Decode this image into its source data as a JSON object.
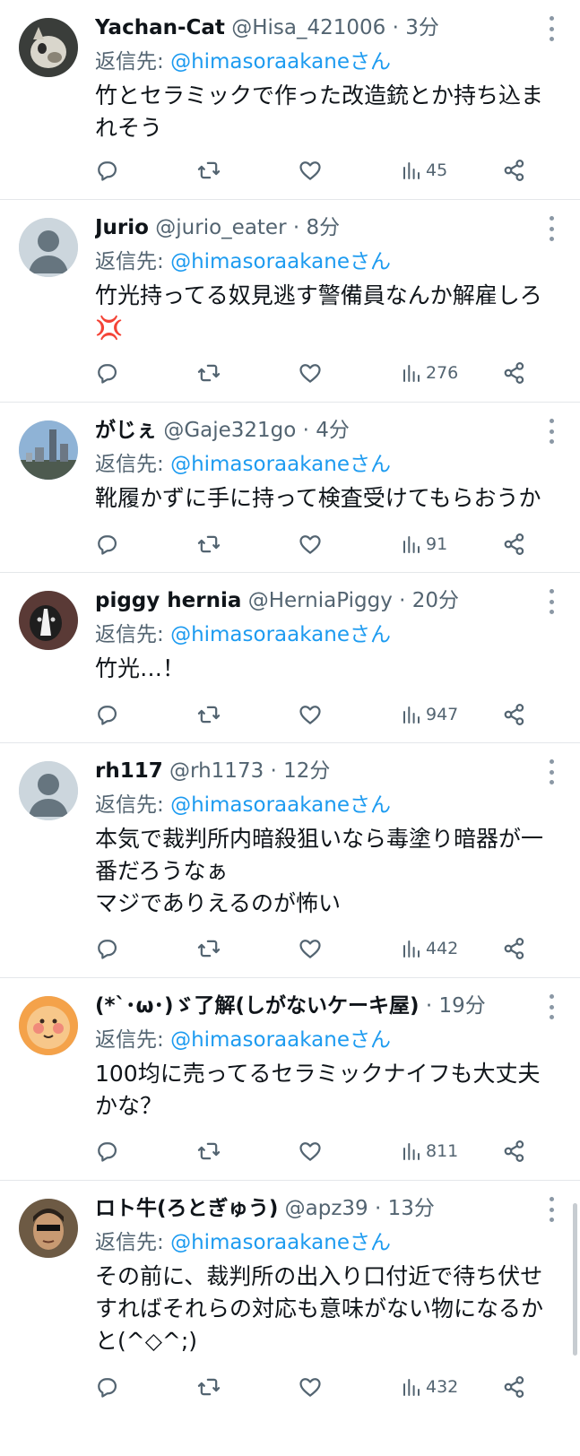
{
  "reply_prefix": "返信先: ",
  "tweets": [
    {
      "name": "Yachan-Cat",
      "handle": "@Hisa_421006",
      "time": "3分",
      "reply_to": "@himasoraakaneさん",
      "text": "竹とセラミックで作った改造銃とか持ち込まれそう",
      "views": "45",
      "avatar": "cat-photo"
    },
    {
      "name": "Jurio",
      "handle": "@jurio_eater",
      "time": "8分",
      "reply_to": "@himasoraakaneさん",
      "text": "竹光持ってる奴見逃す警備員なんか解雇しろ💢",
      "views": "276",
      "avatar": "default-user"
    },
    {
      "name": "がじぇ",
      "handle": "@Gaje321go",
      "time": "4分",
      "reply_to": "@himasoraakaneさん",
      "text": "靴履かずに手に持って検査受けてもらおうか",
      "views": "91",
      "avatar": "city-skyline-photo"
    },
    {
      "name": "piggy hernia",
      "handle": "@HerniaPiggy",
      "time": "20分",
      "reply_to": "@himasoraakaneさん",
      "text": "竹光…！",
      "views": "947",
      "avatar": "dog-photo"
    },
    {
      "name": "rh117",
      "handle": "@rh1173",
      "time": "12分",
      "reply_to": "@himasoraakaneさん",
      "text": "本気で裁判所内暗殺狙いなら毒塗り暗器が一番だろうなぁ\nマジでありえるのが怖い",
      "views": "442",
      "avatar": "default-user"
    },
    {
      "name": "(*`･ω･)ゞ了解(しがないケーキ屋)",
      "handle": "",
      "time": "19分",
      "reply_to": "@himasoraakaneさん",
      "text": "100均に売ってるセラミックナイフも大丈夫かな？",
      "views": "811",
      "avatar": "cartoon-face"
    },
    {
      "name": "ロト牛(ろとぎゅう)",
      "handle": "@apz39",
      "time": "13分",
      "reply_to": "@himasoraakaneさん",
      "text": "その前に、裁判所の出入り口付近で待ち伏せすればそれらの対応も意味がない物になるかと(^◇^;)",
      "views": "432",
      "avatar": "person-photo"
    }
  ],
  "colors": {
    "link": "#1d9bf0",
    "secondary": "#536471",
    "divider": "#e4e7ea"
  }
}
